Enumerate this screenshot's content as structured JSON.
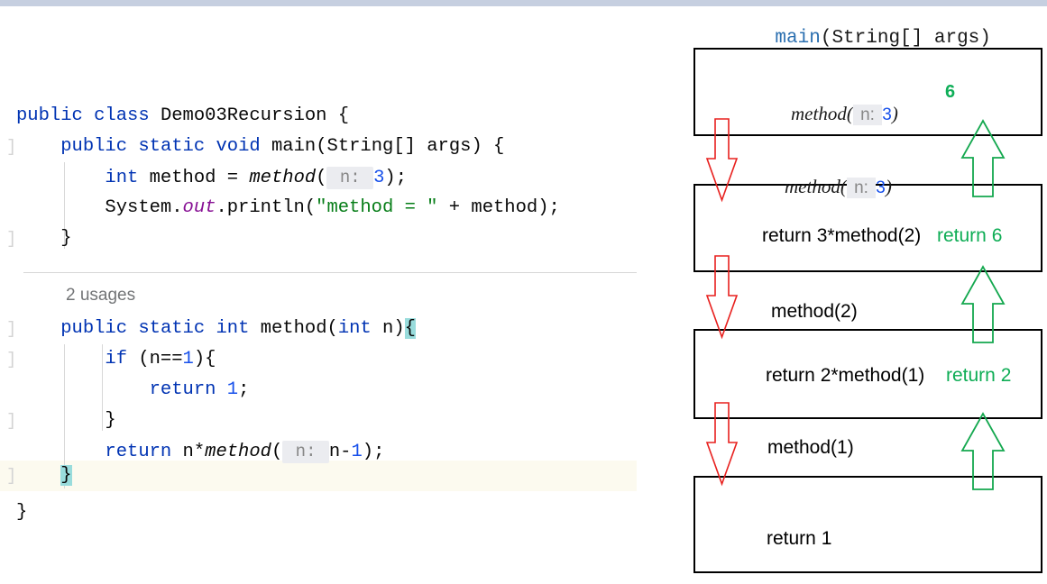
{
  "window": {
    "topbar_color": "#c6cfe0"
  },
  "editor": {
    "usages_label": "2 usages",
    "lines": [
      {
        "indent": 0,
        "fold": false,
        "tokens": [
          {
            "t": "public",
            "c": "kw"
          },
          {
            "t": " ",
            "c": "plain"
          },
          {
            "t": "class",
            "c": "kw"
          },
          {
            "t": " Demo03Recursion {",
            "c": "plain"
          }
        ]
      },
      {
        "indent": 0,
        "fold": true,
        "tokens": [
          {
            "t": "    ",
            "c": "plain"
          },
          {
            "t": "public",
            "c": "kw"
          },
          {
            "t": " ",
            "c": "plain"
          },
          {
            "t": "static",
            "c": "kw"
          },
          {
            "t": " ",
            "c": "plain"
          },
          {
            "t": "void",
            "c": "kw"
          },
          {
            "t": " ",
            "c": "plain"
          },
          {
            "t": "main",
            "c": "plain"
          },
          {
            "t": "(String[] args) {",
            "c": "plain"
          }
        ]
      },
      {
        "indent": 0,
        "fold": false,
        "tokens": [
          {
            "t": "        ",
            "c": "plain"
          },
          {
            "t": "int",
            "c": "kw"
          },
          {
            "t": " method = ",
            "c": "plain"
          },
          {
            "t": "method",
            "c": "mth"
          },
          {
            "t": "(",
            "c": "plain"
          },
          {
            "t": " n: ",
            "c": "hint"
          },
          {
            "t": "3",
            "c": "num"
          },
          {
            "t": ");",
            "c": "plain"
          }
        ]
      },
      {
        "indent": 0,
        "fold": false,
        "tokens": [
          {
            "t": "        System.",
            "c": "plain"
          },
          {
            "t": "out",
            "c": "fld"
          },
          {
            "t": ".println(",
            "c": "plain"
          },
          {
            "t": "\"method = \"",
            "c": "str"
          },
          {
            "t": " + method);",
            "c": "plain"
          }
        ]
      },
      {
        "indent": 0,
        "fold": true,
        "tokens": [
          {
            "t": "    }",
            "c": "plain"
          }
        ]
      },
      {
        "indent": 0,
        "fold": true,
        "tokens": [
          {
            "t": "    ",
            "c": "plain"
          },
          {
            "t": "public",
            "c": "kw"
          },
          {
            "t": " ",
            "c": "plain"
          },
          {
            "t": "static",
            "c": "kw"
          },
          {
            "t": " ",
            "c": "plain"
          },
          {
            "t": "int",
            "c": "kw"
          },
          {
            "t": " ",
            "c": "plain"
          },
          {
            "t": "method",
            "c": "plain"
          },
          {
            "t": "(",
            "c": "plain"
          },
          {
            "t": "int",
            "c": "kw"
          },
          {
            "t": " n)",
            "c": "plain"
          },
          {
            "t": "{",
            "c": "brace-hl"
          }
        ]
      },
      {
        "indent": 0,
        "fold": true,
        "tokens": [
          {
            "t": "        ",
            "c": "plain"
          },
          {
            "t": "if",
            "c": "kw"
          },
          {
            "t": " (n==",
            "c": "plain"
          },
          {
            "t": "1",
            "c": "num"
          },
          {
            "t": "){",
            "c": "plain"
          }
        ]
      },
      {
        "indent": 0,
        "fold": false,
        "tokens": [
          {
            "t": "            ",
            "c": "plain"
          },
          {
            "t": "return",
            "c": "kw"
          },
          {
            "t": " ",
            "c": "plain"
          },
          {
            "t": "1",
            "c": "num"
          },
          {
            "t": ";",
            "c": "plain"
          }
        ]
      },
      {
        "indent": 0,
        "fold": true,
        "tokens": [
          {
            "t": "        }",
            "c": "plain"
          }
        ]
      },
      {
        "indent": 0,
        "fold": false,
        "tokens": [
          {
            "t": "        ",
            "c": "plain"
          },
          {
            "t": "return",
            "c": "kw"
          },
          {
            "t": " n*",
            "c": "plain"
          },
          {
            "t": "method",
            "c": "mth"
          },
          {
            "t": "(",
            "c": "plain"
          },
          {
            "t": " n: ",
            "c": "hint"
          },
          {
            "t": "n-",
            "c": "plain"
          },
          {
            "t": "1",
            "c": "num"
          },
          {
            "t": ");",
            "c": "plain"
          }
        ]
      },
      {
        "indent": 0,
        "fold": true,
        "current": true,
        "tokens": [
          {
            "t": "    ",
            "c": "plain"
          },
          {
            "t": "}",
            "c": "brace-hl"
          }
        ]
      },
      {
        "indent": 0,
        "fold": false,
        "tokens": [
          {
            "t": "}",
            "c": "plain"
          }
        ]
      }
    ]
  },
  "diagram": {
    "header": {
      "name": "main",
      "params": "(String[] args)"
    },
    "frames": [
      {
        "call_prefix": "method(",
        "call_hint": " n: ",
        "call_arg": "3",
        "call_suffix": ")",
        "value": "6",
        "body": "",
        "ret": ""
      },
      {
        "body": "return 3*method(2)",
        "ret": "return 6"
      },
      {
        "body": "return 2*method(1)",
        "ret": "return 2"
      },
      {
        "body": "return 1",
        "ret": ""
      }
    ],
    "between_labels": [
      {
        "prefix": "method(",
        "hint": " n: ",
        "arg": "3",
        "suffix": ")",
        "italic": true
      },
      {
        "plain": "method(2)",
        "italic": false
      },
      {
        "plain": "method(1)",
        "italic": false
      }
    ],
    "colors": {
      "call_arrow": "#e8201e",
      "return_arrow": "#14a84f",
      "return_text": "#0ead55",
      "box_border": "#000000"
    }
  }
}
